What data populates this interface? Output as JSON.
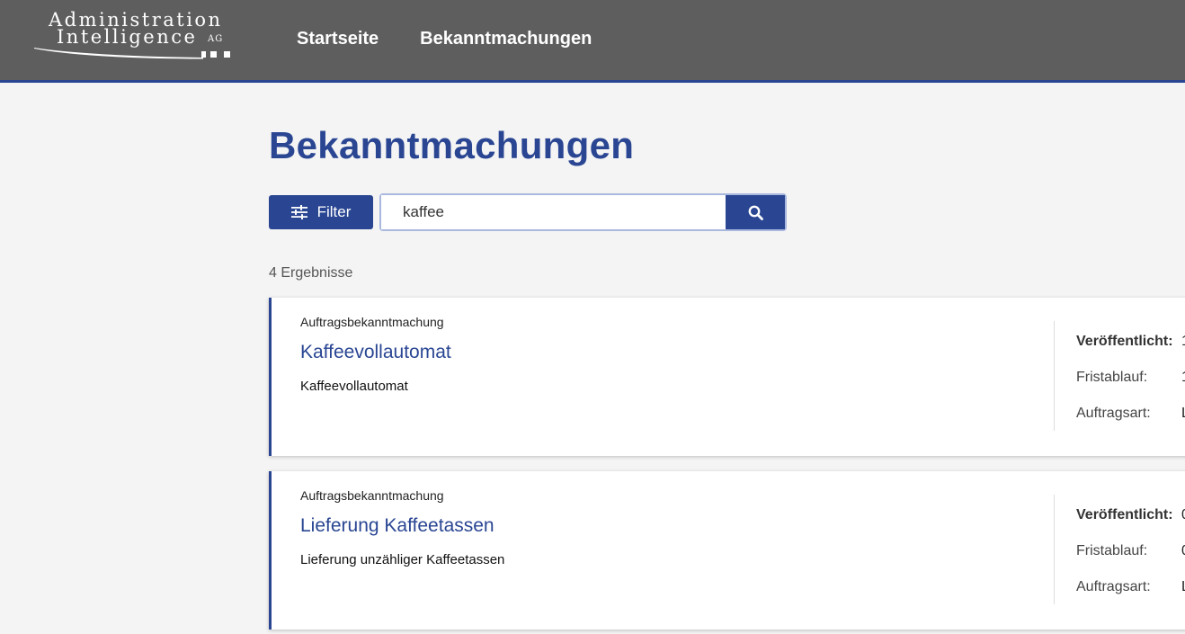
{
  "header": {
    "logo": {
      "line1": "Administration",
      "line2": "Intelligence",
      "suffix": "AG"
    },
    "nav": [
      {
        "label": "Startseite"
      },
      {
        "label": "Bekanntmachungen"
      }
    ]
  },
  "page": {
    "title": "Bekanntmachungen",
    "filter_label": "Filter",
    "search": {
      "value": "kaffee"
    },
    "result_count": "4 Ergebnisse"
  },
  "results": [
    {
      "type": "Auftragsbekanntmachung",
      "title": "Kaffeevollautomat",
      "description": "Kaffeevollautomat",
      "meta": [
        {
          "label": "Veröffentlicht:",
          "value": "1"
        },
        {
          "label": "Fristablauf:",
          "value": "1"
        },
        {
          "label": "Auftragsart:",
          "value": "L"
        }
      ]
    },
    {
      "type": "Auftragsbekanntmachung",
      "title": "Lieferung Kaffeetassen",
      "description": "Lieferung unzähliger Kaffeetassen",
      "meta": [
        {
          "label": "Veröffentlicht:",
          "value": "0"
        },
        {
          "label": "Fristablauf:",
          "value": "0"
        },
        {
          "label": "Auftragsart:",
          "value": "L"
        }
      ]
    }
  ],
  "colors": {
    "header_bg": "#5e5e5e",
    "accent": "#2a4693",
    "page_bg": "#f4f4f4"
  }
}
